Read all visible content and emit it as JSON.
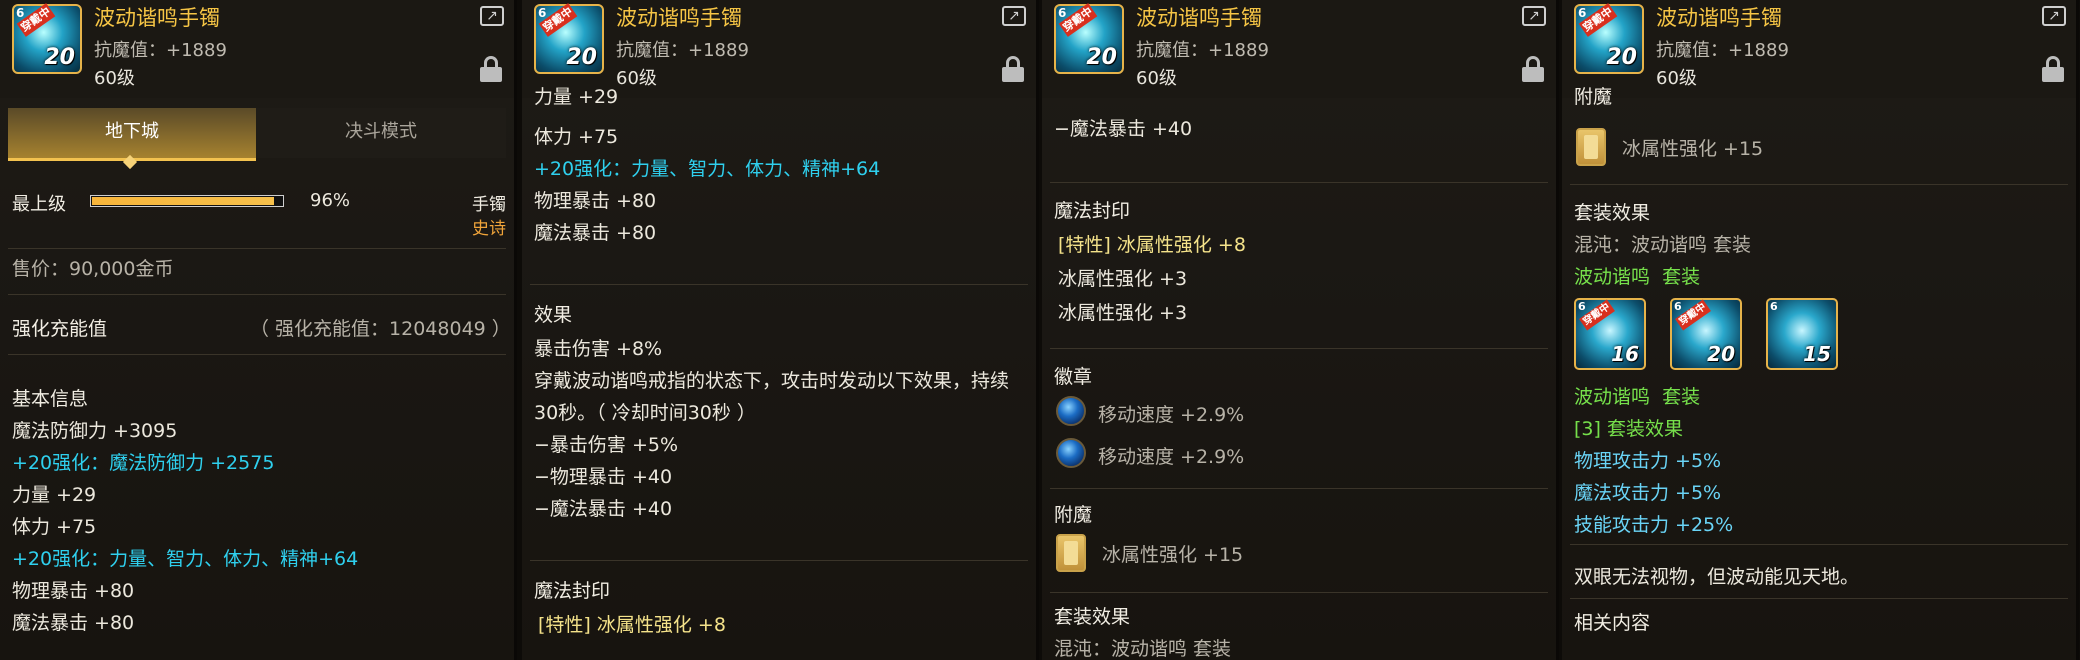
{
  "item": {
    "name": "波动谐鸣手镯",
    "magic_resist": "抗魔值：+1889",
    "level": "60级",
    "icon_badge": "穿戴中",
    "icon_grade": "20",
    "icon_corner": "6"
  },
  "tabs": [
    "地下城",
    "决斗模式"
  ],
  "grade": {
    "label": "最上级",
    "percent": "96%",
    "percent_value": 0.96,
    "type": "手镯",
    "rarity": "史诗"
  },
  "price": "售价：90,000金币",
  "charge": {
    "label": "强化充能值",
    "value": "（ 强化充能值：12048049 ）"
  },
  "basic": {
    "title": "基本信息",
    "magic_def": "魔法防御力 +3095",
    "reinforce_def": "+20强化：魔法防御力 +2575",
    "str": "力量 +29",
    "vit": "体力 +75",
    "reinforce_all": "+20强化：力量、智力、体力、精神+64",
    "phys_crit": "物理暴击 +80",
    "magic_crit": "魔法暴击 +80"
  },
  "effect": {
    "title": "效果",
    "crit_dmg": "暴击伤害 +8%",
    "desc_line1": "穿戴波动谐鸣戒指的状态下，攻击时发动以下效果，持续",
    "desc_line2": "30秒。（ 冷却时间30秒 ）",
    "b1": "−暴击伤害 +5%",
    "b2": "−物理暴击 +40",
    "b3": "−魔法暴击 +40",
    "partial_top": "力量 +29"
  },
  "seal": {
    "title": "魔法封印",
    "special": "[特性] 冰属性强化 +8",
    "s1": "冰属性强化 +3",
    "s2": "冰属性强化 +3"
  },
  "emblem": {
    "title": "徽章",
    "e1": "移动速度 +2.9%",
    "e2": "移动速度 +2.9%"
  },
  "enchant": {
    "title": "附魔",
    "value": "冰属性强化 +15"
  },
  "set": {
    "title": "套装效果",
    "chaos": "混沌：波动谐鸣 套装",
    "name": "波动谐鸣",
    "suffix": "套装",
    "icons": [
      {
        "badge": "穿戴中",
        "num": "16",
        "corner": "6"
      },
      {
        "badge": "穿戴中",
        "num": "20",
        "corner": "6"
      },
      {
        "badge": "",
        "num": "15",
        "corner": "6"
      }
    ],
    "bonus_title": "[3] 套装效果",
    "bonus1": "物理攻击力 +5%",
    "bonus2": "魔法攻击力 +5%",
    "bonus3": "技能攻击力 +25%",
    "flavor": "双眼无法视物，但波动能见天地。",
    "related": "相关内容",
    "partial_chaos": "混沌：波动谐鸣 套装"
  },
  "colors": {
    "title": "#f6c545",
    "reinforce": "#2fd0ee",
    "set_green": "#76e04b",
    "set_blue": "#6ad4f6",
    "rarity": "#f0a43a"
  },
  "icons": [
    "share-icon",
    "lock-icon",
    "emblem-gem-icon",
    "enchant-card-icon"
  ]
}
